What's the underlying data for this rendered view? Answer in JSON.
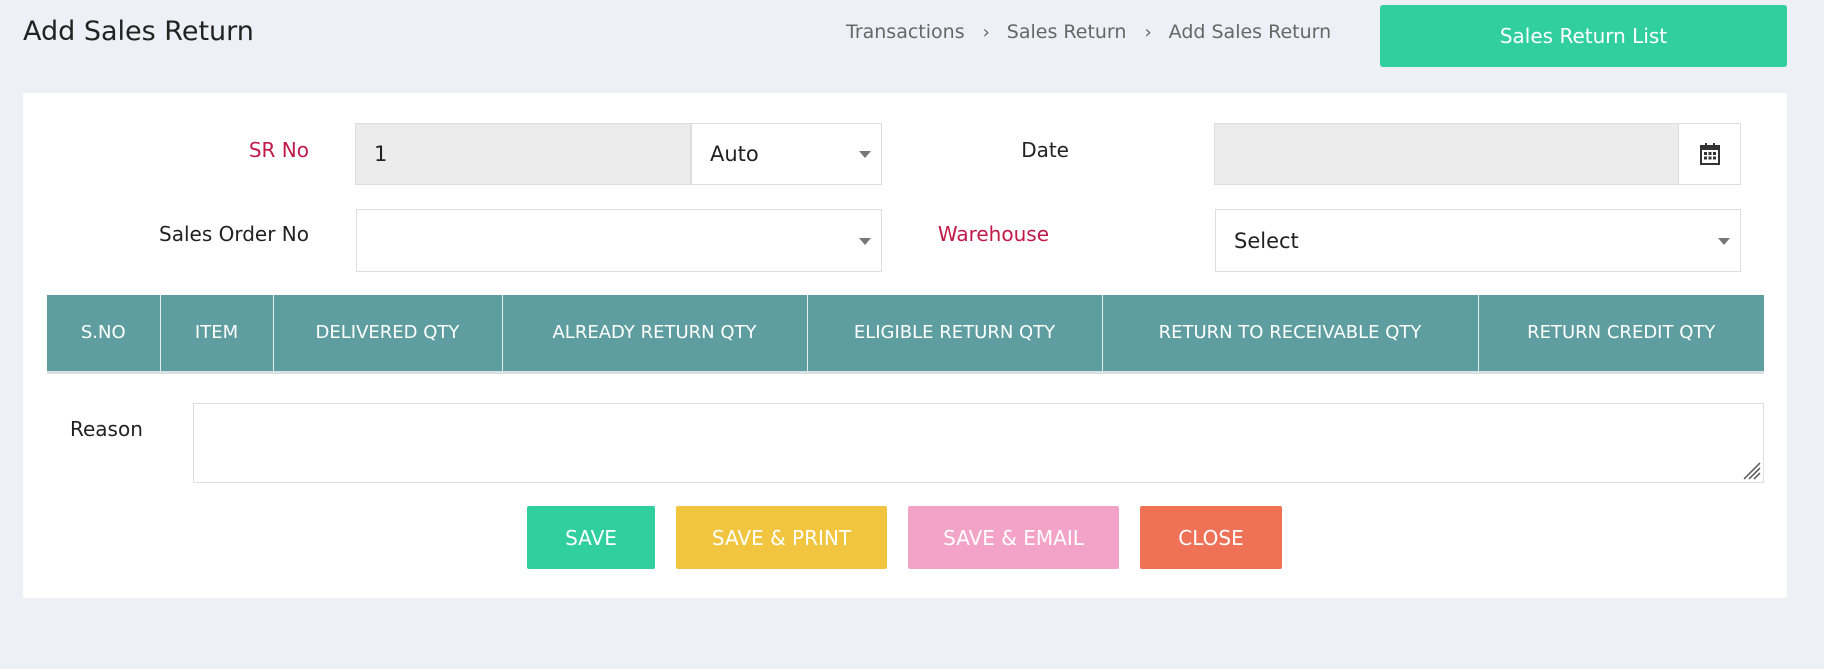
{
  "header": {
    "title": "Add Sales Return",
    "breadcrumb": [
      "Transactions",
      "Sales Return",
      "Add Sales Return"
    ],
    "list_button": "Sales Return List"
  },
  "form": {
    "sr_no_label": "SR No",
    "sr_no_value": "1",
    "sr_mode_value": "Auto",
    "date_label": "Date",
    "date_value": "",
    "sales_order_label": "Sales Order No",
    "sales_order_value": "",
    "warehouse_label": "Warehouse",
    "warehouse_value": "Select"
  },
  "table": {
    "columns": [
      "S.NO",
      "ITEM",
      "DELIVERED QTY",
      "ALREADY RETURN QTY",
      "ELIGIBLE RETURN QTY",
      "RETURN TO RECEIVABLE QTY",
      "RETURN CREDIT QTY"
    ],
    "rows": []
  },
  "reason": {
    "label": "Reason",
    "value": ""
  },
  "actions": {
    "save": "SAVE",
    "save_print": "SAVE & PRINT",
    "save_email": "SAVE & EMAIL",
    "close": "CLOSE"
  },
  "colors": {
    "accent_green": "#31cf9b",
    "header_teal": "#5f9ea0",
    "print_yellow": "#f1c53f",
    "email_pink": "#f3a3c8",
    "close_red": "#ef7257",
    "required_red": "#c2194b",
    "background": "#edf0f5"
  },
  "icons": {
    "calendar": "calendar-icon",
    "dropdown": "chevron-down-icon",
    "resize": "resize-grip-icon",
    "breadcrumb_separator": "chevron-right-icon"
  }
}
